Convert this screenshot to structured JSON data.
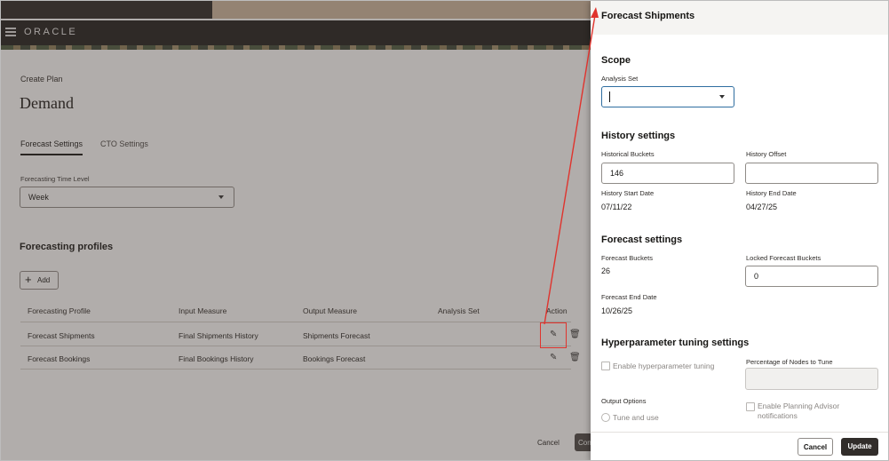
{
  "app": {
    "brand": "ORACLE",
    "breadcrumb": "Create Plan",
    "page_title": "Demand",
    "tabs": [
      {
        "label": "Forecast Settings",
        "active": true
      },
      {
        "label": "CTO Settings",
        "active": false
      }
    ],
    "forecasting_time_level": {
      "label": "Forecasting Time Level",
      "value": "Week"
    },
    "profiles_title": "Forecasting profiles",
    "add_label": "Add",
    "table": {
      "headers": [
        "Forecasting Profile",
        "Input Measure",
        "Output Measure",
        "Analysis Set",
        "Action"
      ],
      "rows": [
        {
          "profile": "Forecast Shipments",
          "input": "Final Shipments History",
          "output": "Shipments Forecast",
          "analysis_set": ""
        },
        {
          "profile": "Forecast Bookings",
          "input": "Final Bookings History",
          "output": "Bookings Forecast",
          "analysis_set": ""
        }
      ]
    },
    "footer": {
      "cancel": "Cancel",
      "continue_partial": "Con"
    }
  },
  "drawer": {
    "title": "Forecast Shipments",
    "scope": {
      "title": "Scope",
      "analysis_set_label": "Analysis Set",
      "analysis_set_value": ""
    },
    "history": {
      "title": "History settings",
      "historical_buckets_label": "Historical Buckets",
      "historical_buckets_value": "146",
      "history_offset_label": "History Offset",
      "history_offset_value": "",
      "start_date_label": "History Start Date",
      "start_date_value": "07/11/22",
      "end_date_label": "History End Date",
      "end_date_value": "04/27/25"
    },
    "forecast": {
      "title": "Forecast settings",
      "buckets_label": "Forecast Buckets",
      "buckets_value": "26",
      "locked_label": "Locked Forecast Buckets",
      "locked_value": "0",
      "end_date_label": "Forecast End Date",
      "end_date_value": "10/26/25"
    },
    "hyper": {
      "title": "Hyperparameter tuning settings",
      "enable_label": "Enable hyperparameter tuning",
      "pct_nodes_label": "Percentage of Nodes to Tune",
      "output_options_label": "Output Options",
      "tune_and_use": "Tune and use",
      "advisor_line1": "Enable Planning Advisor",
      "advisor_line2": "notifications"
    },
    "buttons": {
      "cancel": "Cancel",
      "update": "Update"
    }
  },
  "colors": {
    "highlight": "#e0332d",
    "primary_button": "#312d2a",
    "focus": "#2f6ea0"
  }
}
